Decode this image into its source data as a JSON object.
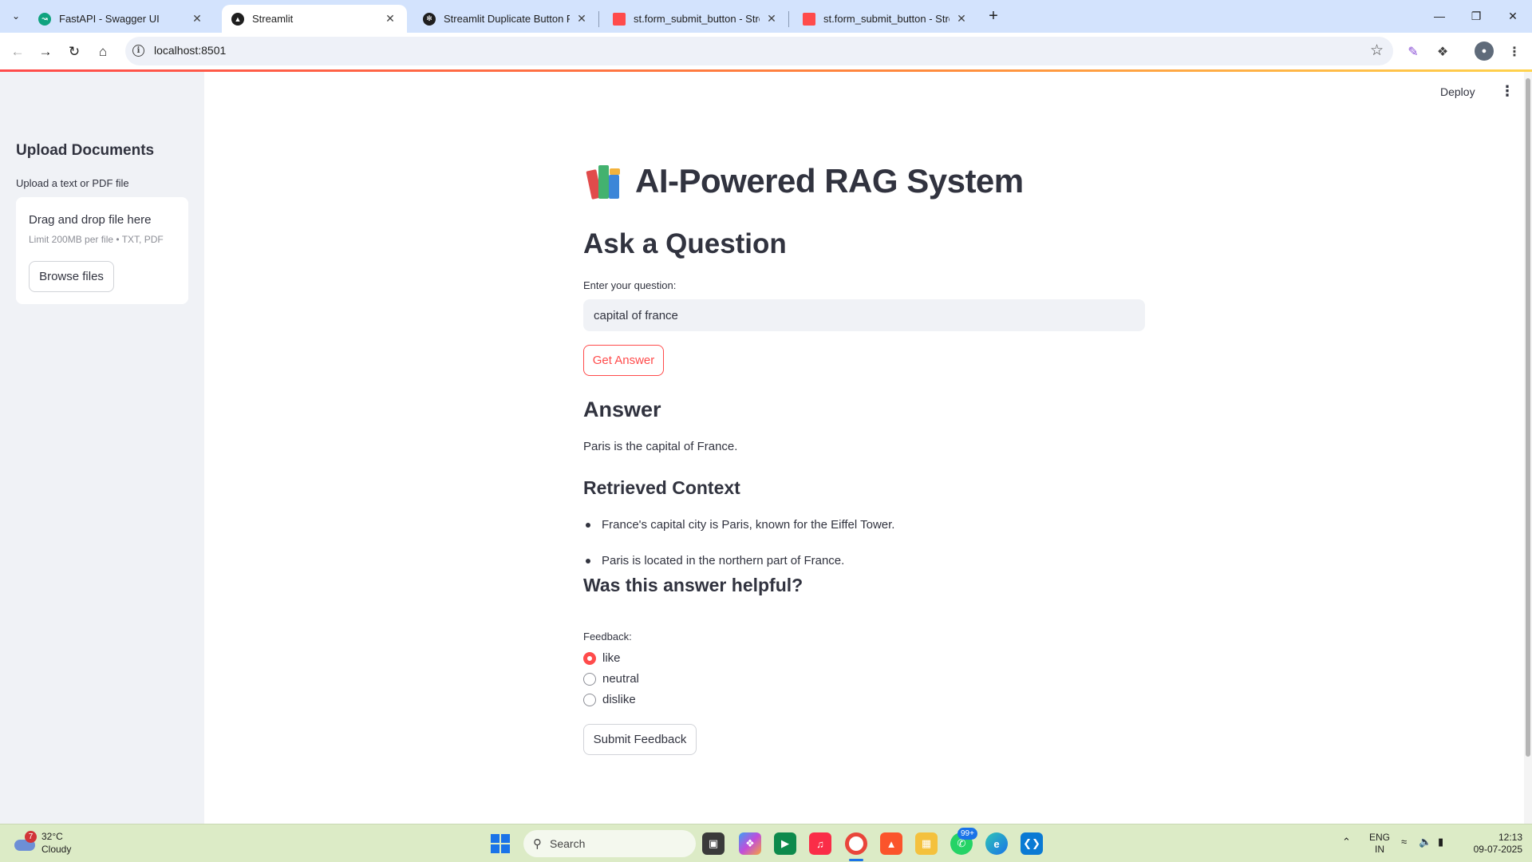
{
  "browser": {
    "tabs": [
      {
        "title": "FastAPI - Swagger UI",
        "favicon_color": "#10a37f",
        "active": false
      },
      {
        "title": "Streamlit",
        "favicon_color": "#1f1f1f",
        "active": true
      },
      {
        "title": "Streamlit Duplicate Button Fix",
        "favicon_color": "#1f1f1f",
        "active": false
      },
      {
        "title": "st.form_submit_button - Stream",
        "favicon_color": "#ff4b4b",
        "active": false
      },
      {
        "title": "st.form_submit_button - Stream",
        "favicon_color": "#ff4b4b",
        "active": false
      }
    ],
    "url": "localhost:8501"
  },
  "app": {
    "deploy_label": "Deploy",
    "sidebar": {
      "title": "Upload Documents",
      "uploader_label": "Upload a text or PDF file",
      "dropzone_title": "Drag and drop file here",
      "dropzone_limit": "Limit 200MB per file • TXT, PDF",
      "browse_label": "Browse files"
    },
    "title": "AI-Powered RAG System",
    "ask_heading": "Ask a Question",
    "question_label": "Enter your question:",
    "question_value": "capital of france",
    "get_answer_label": "Get Answer",
    "answer_heading": "Answer",
    "answer_text": "Paris is the capital of France.",
    "context_heading": "Retrieved Context",
    "context_items": [
      "France's capital city is Paris, known for the Eiffel Tower.",
      "Paris is located in the northern part of France."
    ],
    "helpful_heading": "Was this answer helpful?",
    "feedback_label": "Feedback:",
    "feedback_options": [
      "like",
      "neutral",
      "dislike"
    ],
    "feedback_selected": "like",
    "submit_label": "Submit Feedback"
  },
  "taskbar": {
    "weather_badge": "7",
    "temperature": "32°C",
    "condition": "Cloudy",
    "search_placeholder": "Search",
    "notification_badge": "99+",
    "language": "ENG",
    "region": "IN",
    "time": "12:13",
    "date": "09-07-2025"
  },
  "colors": {
    "accent": "#ff4b4b",
    "sidebar_bg": "#f0f2f6",
    "text": "#31333f",
    "taskbar_bg": "#dcebc6"
  }
}
